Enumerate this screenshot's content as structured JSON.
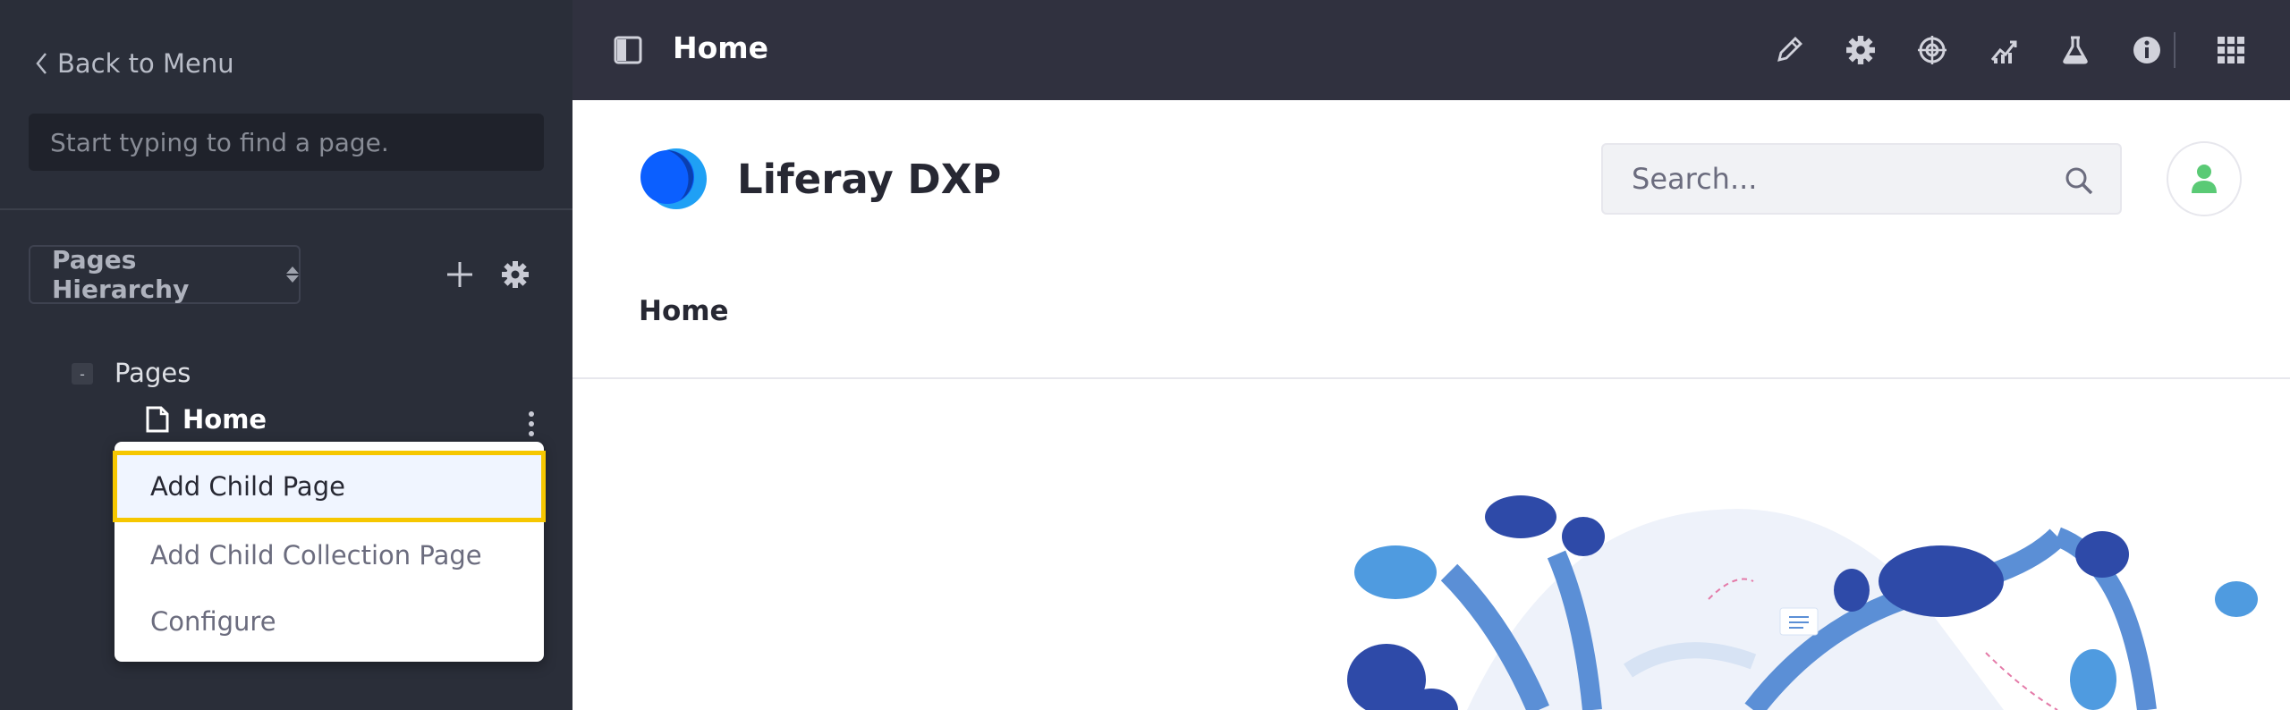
{
  "sidebar": {
    "back_label": "Back to Menu",
    "search_placeholder": "Start typing to find a page.",
    "hierarchy_label": "Pages Hierarchy",
    "tree": {
      "root_label": "Pages",
      "toggle": "-",
      "child_label": "Home"
    },
    "menu": {
      "items": [
        {
          "label": "Add Child Page",
          "active": true
        },
        {
          "label": "Add Child Collection Page",
          "active": false
        },
        {
          "label": "Configure",
          "active": false
        }
      ]
    }
  },
  "topbar": {
    "title": "Home",
    "icons": [
      "sidebar-toggle-icon",
      "pencil-icon",
      "gear-icon",
      "target-icon",
      "analytics-icon",
      "flask-icon",
      "info-icon",
      "apps-grid-icon"
    ]
  },
  "site": {
    "name": "Liferay DXP",
    "search_placeholder": "Search...",
    "nav_home": "Home"
  },
  "colors": {
    "sidebar_bg": "#2a2e39",
    "topbar_bg": "#30313f",
    "highlight": "#f6c700",
    "accent_blue": "#0b5fff",
    "avatar_green": "#5aca75"
  }
}
